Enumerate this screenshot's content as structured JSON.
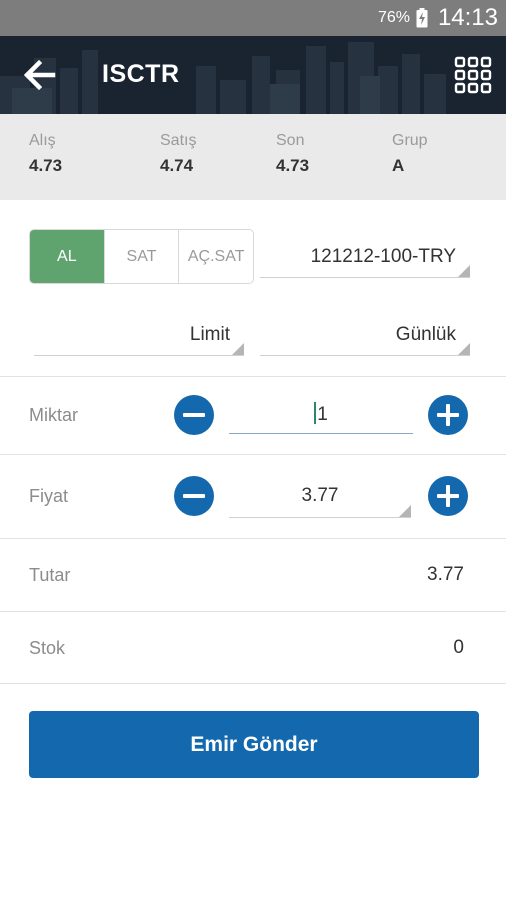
{
  "status_bar": {
    "battery_percent": "76%",
    "time": "14:13",
    "icons": [
      "battery-charging-icon"
    ]
  },
  "app_bar": {
    "title": "ISCTR",
    "icons": [
      "back-arrow-icon",
      "grid-menu-icon"
    ]
  },
  "quote": [
    {
      "label": "Alış",
      "value": "4.73"
    },
    {
      "label": "Satış",
      "value": "4.74"
    },
    {
      "label": "Son",
      "value": "4.73"
    },
    {
      "label": "Grup",
      "value": "A"
    }
  ],
  "order_side": {
    "options": [
      "AL",
      "SAT",
      "AÇ.SAT"
    ],
    "selected": "AL"
  },
  "account": {
    "value": "121212-100-TRY"
  },
  "order_type": {
    "value": "Limit"
  },
  "validity": {
    "value": "Günlük"
  },
  "quantity": {
    "label": "Miktar",
    "value": "1"
  },
  "price": {
    "label": "Fiyat",
    "value": "3.77"
  },
  "total": {
    "label": "Tutar",
    "value": "3.77"
  },
  "stock": {
    "label": "Stok",
    "value": "0"
  },
  "submit": {
    "label": "Emir Gönder"
  },
  "colors": {
    "accent": "#1468ae",
    "buy_green": "#5fa46f",
    "header_dark": "#1a2430"
  }
}
